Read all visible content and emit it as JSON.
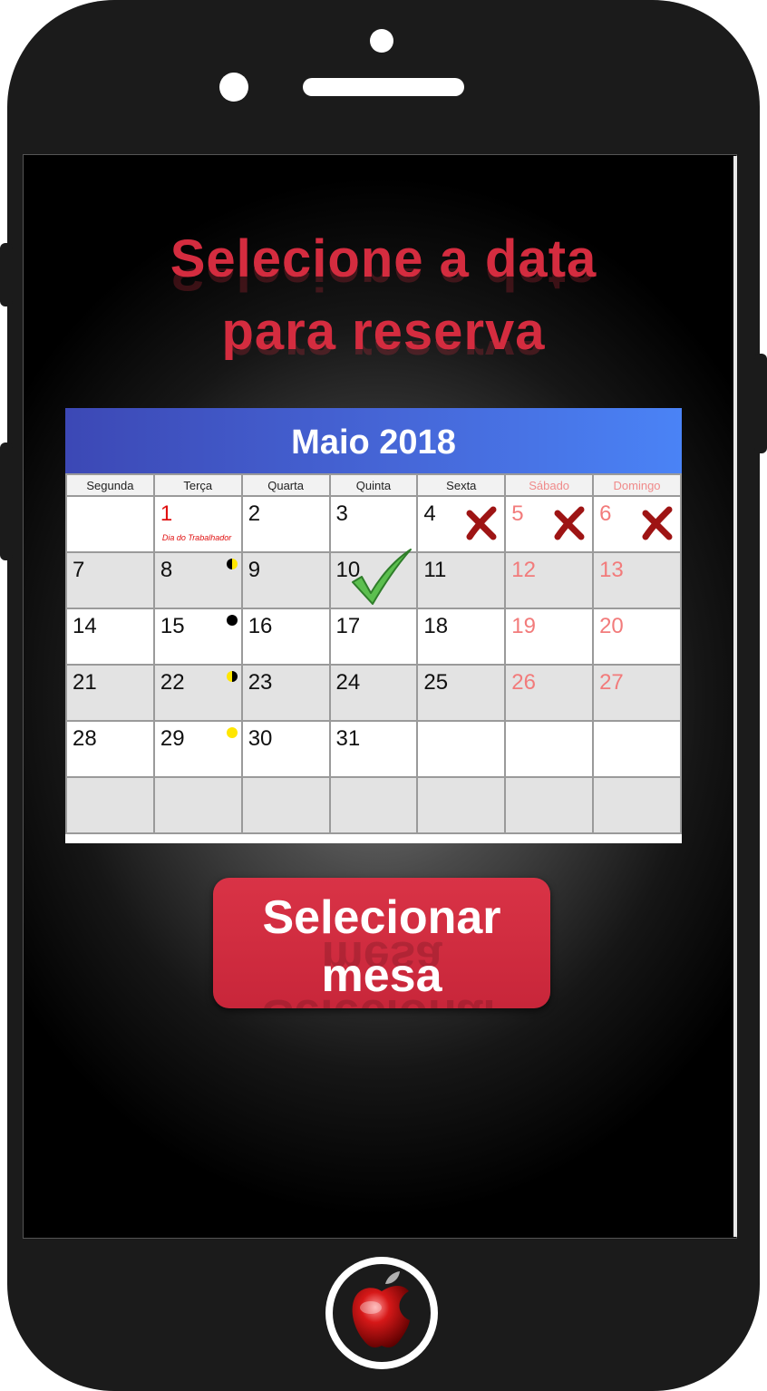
{
  "heading": {
    "line1": "Selecione a data",
    "line2": "para reserva"
  },
  "calendar": {
    "title": "Maio 2018",
    "weekdays": [
      {
        "label": "Segunda",
        "weekend": false
      },
      {
        "label": "Terça",
        "weekend": false
      },
      {
        "label": "Quarta",
        "weekend": false
      },
      {
        "label": "Quinta",
        "weekend": false
      },
      {
        "label": "Sexta",
        "weekend": false
      },
      {
        "label": "Sábado",
        "weekend": true
      },
      {
        "label": "Domingo",
        "weekend": true
      }
    ],
    "weeks": [
      [
        null,
        {
          "day": "1",
          "holiday": "Dia do Trabalhador",
          "style": "red"
        },
        {
          "day": "2"
        },
        {
          "day": "3"
        },
        {
          "day": "4",
          "status": "unavailable"
        },
        {
          "day": "5",
          "style": "pink",
          "status": "unavailable"
        },
        {
          "day": "6",
          "style": "pink",
          "status": "unavailable"
        }
      ],
      [
        {
          "day": "7"
        },
        {
          "day": "8",
          "moon": "first-quarter"
        },
        {
          "day": "9"
        },
        {
          "day": "10",
          "status": "selected"
        },
        {
          "day": "11"
        },
        {
          "day": "12",
          "style": "pink"
        },
        {
          "day": "13",
          "style": "pink"
        }
      ],
      [
        {
          "day": "14"
        },
        {
          "day": "15",
          "moon": "new"
        },
        {
          "day": "16"
        },
        {
          "day": "17"
        },
        {
          "day": "18"
        },
        {
          "day": "19",
          "style": "pink"
        },
        {
          "day": "20",
          "style": "pink"
        }
      ],
      [
        {
          "day": "21"
        },
        {
          "day": "22",
          "moon": "last-quarter"
        },
        {
          "day": "23"
        },
        {
          "day": "24"
        },
        {
          "day": "25"
        },
        {
          "day": "26",
          "style": "pink"
        },
        {
          "day": "27",
          "style": "pink"
        }
      ],
      [
        {
          "day": "28"
        },
        {
          "day": "29",
          "moon": "full"
        },
        {
          "day": "30"
        },
        {
          "day": "31"
        },
        null,
        null,
        null
      ],
      [
        null,
        null,
        null,
        null,
        null,
        null,
        null
      ]
    ],
    "row_shading": [
      "white",
      "grey",
      "white",
      "grey",
      "white",
      "grey"
    ]
  },
  "action_button": {
    "line1": "Selecionar",
    "line2": "mesa"
  },
  "home_button": {
    "icon": "apple-logo-icon"
  },
  "colors": {
    "accent": "#d42c3f",
    "calendar_header": "#4667d8",
    "holiday": "#e01010",
    "weekend": "#f27b7b",
    "unavailable": "#a01818",
    "selected": "#4caf50"
  }
}
